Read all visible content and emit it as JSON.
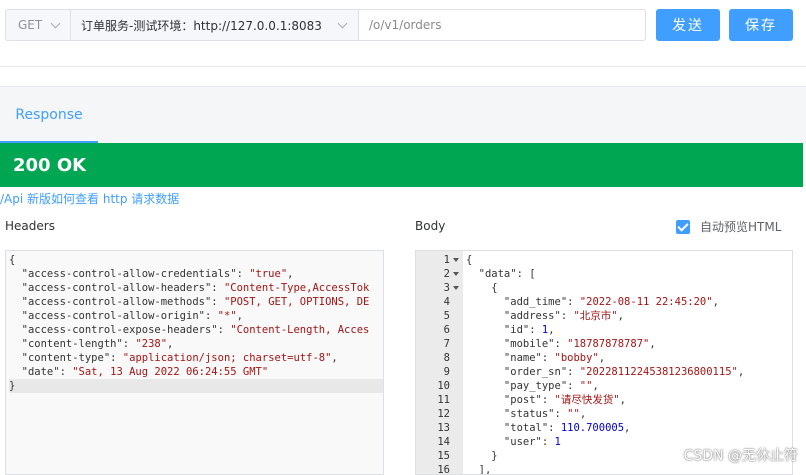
{
  "request": {
    "method": "GET",
    "environment": "订单服务-测试环境：http://127.0.0.1:8083",
    "path": "/o/v1/orders",
    "send_label": "发送",
    "save_label": "保存"
  },
  "response": {
    "tab_label": "Response",
    "status": "200 OK",
    "help_link": "/Api 新版如何查看 http 请求数据",
    "headers_label": "Headers",
    "body_label": "Body",
    "preview_label": "自动预览HTML",
    "preview_checked": true
  },
  "headers_lines": [
    [
      {
        "t": "{",
        "c": "p"
      }
    ],
    [
      {
        "t": "  \"access-control-allow-credentials\": ",
        "c": "k"
      },
      {
        "t": "\"true\"",
        "c": "s"
      },
      {
        "t": ",",
        "c": "p"
      }
    ],
    [
      {
        "t": "  \"access-control-allow-headers\": ",
        "c": "k"
      },
      {
        "t": "\"Content-Type,AccessTok",
        "c": "s"
      }
    ],
    [
      {
        "t": "  \"access-control-allow-methods\": ",
        "c": "k"
      },
      {
        "t": "\"POST, GET, OPTIONS, DE",
        "c": "s"
      }
    ],
    [
      {
        "t": "  \"access-control-allow-origin\": ",
        "c": "k"
      },
      {
        "t": "\"*\"",
        "c": "s"
      },
      {
        "t": ",",
        "c": "p"
      }
    ],
    [
      {
        "t": "  \"access-control-expose-headers\": ",
        "c": "k"
      },
      {
        "t": "\"Content-Length, Acces",
        "c": "s"
      }
    ],
    [
      {
        "t": "  \"content-length\": ",
        "c": "k"
      },
      {
        "t": "\"238\"",
        "c": "s"
      },
      {
        "t": ",",
        "c": "p"
      }
    ],
    [
      {
        "t": "  \"content-type\": ",
        "c": "k"
      },
      {
        "t": "\"application/json; charset=utf-8\"",
        "c": "s"
      },
      {
        "t": ",",
        "c": "p"
      }
    ],
    [
      {
        "t": "  \"date\": ",
        "c": "k"
      },
      {
        "t": "\"Sat, 13 Aug 2022 06:24:55 GMT\"",
        "c": "s"
      }
    ],
    [
      {
        "t": "}",
        "c": "p"
      }
    ]
  ],
  "body_gutter": [
    {
      "n": "1",
      "fold": true
    },
    {
      "n": "2",
      "fold": true
    },
    {
      "n": "3",
      "fold": true
    },
    {
      "n": "4"
    },
    {
      "n": "5"
    },
    {
      "n": "6"
    },
    {
      "n": "7"
    },
    {
      "n": "8"
    },
    {
      "n": "9"
    },
    {
      "n": "10"
    },
    {
      "n": "11"
    },
    {
      "n": "12"
    },
    {
      "n": "13"
    },
    {
      "n": "14"
    },
    {
      "n": "15"
    },
    {
      "n": "16"
    }
  ],
  "body_lines": [
    [
      {
        "t": "{",
        "c": "p"
      }
    ],
    [
      {
        "t": "  \"data\": [",
        "c": "k"
      }
    ],
    [
      {
        "t": "    {",
        "c": "p"
      }
    ],
    [
      {
        "t": "      \"add_time\": ",
        "c": "k"
      },
      {
        "t": "\"2022-08-11 22:45:20\"",
        "c": "s"
      },
      {
        "t": ",",
        "c": "p"
      }
    ],
    [
      {
        "t": "      \"address\": ",
        "c": "k"
      },
      {
        "t": "\"北京市\"",
        "c": "s"
      },
      {
        "t": ",",
        "c": "p"
      }
    ],
    [
      {
        "t": "      \"id\": ",
        "c": "k"
      },
      {
        "t": "1",
        "c": "n"
      },
      {
        "t": ",",
        "c": "p"
      }
    ],
    [
      {
        "t": "      \"mobile\": ",
        "c": "k"
      },
      {
        "t": "\"18787878787\"",
        "c": "s"
      },
      {
        "t": ",",
        "c": "p"
      }
    ],
    [
      {
        "t": "      \"name\": ",
        "c": "k"
      },
      {
        "t": "\"bobby\"",
        "c": "s"
      },
      {
        "t": ",",
        "c": "p"
      }
    ],
    [
      {
        "t": "      \"order_sn\": ",
        "c": "k"
      },
      {
        "t": "\"20228112245381236800115\"",
        "c": "s"
      },
      {
        "t": ",",
        "c": "p"
      }
    ],
    [
      {
        "t": "      \"pay_type\": ",
        "c": "k"
      },
      {
        "t": "\"\"",
        "c": "s"
      },
      {
        "t": ",",
        "c": "p"
      }
    ],
    [
      {
        "t": "      \"post\": ",
        "c": "k"
      },
      {
        "t": "\"请尽快发货\"",
        "c": "s"
      },
      {
        "t": ",",
        "c": "p"
      }
    ],
    [
      {
        "t": "      \"status\": ",
        "c": "k"
      },
      {
        "t": "\"\"",
        "c": "s"
      },
      {
        "t": ",",
        "c": "p"
      }
    ],
    [
      {
        "t": "      \"total\": ",
        "c": "k"
      },
      {
        "t": "110.700005",
        "c": "n"
      },
      {
        "t": ",",
        "c": "p"
      }
    ],
    [
      {
        "t": "      \"user\": ",
        "c": "k"
      },
      {
        "t": "1",
        "c": "n"
      }
    ],
    [
      {
        "t": "    }",
        "c": "p"
      }
    ],
    [
      {
        "t": "  ],",
        "c": "p"
      }
    ]
  ],
  "watermark": "CSDN @无休止符",
  "colors": {
    "accent": "#409eff",
    "status_ok": "#00a651",
    "string": "#a31515",
    "number": "#0000cd"
  }
}
